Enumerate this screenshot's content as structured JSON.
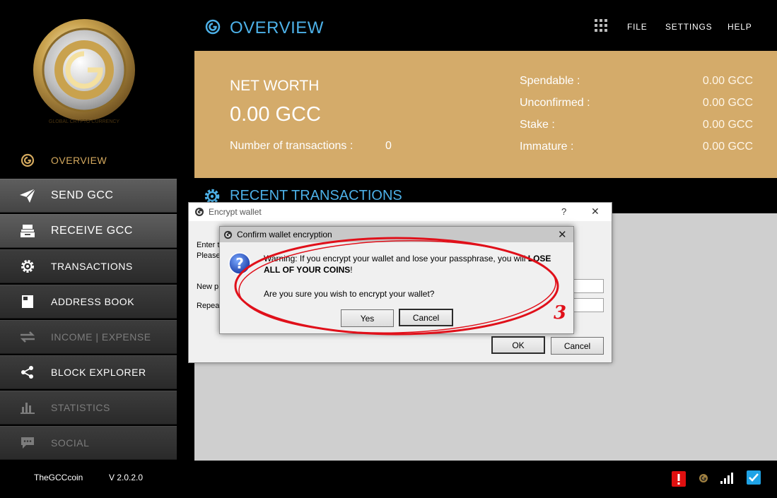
{
  "header": {
    "title": "OVERVIEW",
    "menu": [
      "FILE",
      "SETTINGS",
      "HELP"
    ]
  },
  "sidebar": {
    "items": [
      {
        "label": "OVERVIEW",
        "icon": "gcc-logo-icon"
      },
      {
        "label": "SEND GCC",
        "icon": "paper-plane-icon"
      },
      {
        "label": "RECEIVE GCC",
        "icon": "inbox-tray-icon"
      },
      {
        "label": "TRANSACTIONS",
        "icon": "gear-icon"
      },
      {
        "label": "ADDRESS BOOK",
        "icon": "book-icon"
      },
      {
        "label": "INCOME | EXPENSE",
        "icon": "exchange-arrows-icon"
      },
      {
        "label": "BLOCK EXPLORER",
        "icon": "share-icon"
      },
      {
        "label": "STATISTICS",
        "icon": "bar-chart-icon"
      },
      {
        "label": "SOCIAL",
        "icon": "chat-bubble-icon"
      }
    ]
  },
  "networth": {
    "label": "NET WORTH",
    "value": "0.00 GCC",
    "tx_label": "Number of transactions :",
    "tx_count": "0",
    "balances": [
      {
        "label": "Spendable :",
        "value": "0.00 GCC"
      },
      {
        "label": "Unconfirmed :",
        "value": "0.00 GCC"
      },
      {
        "label": "Stake :",
        "value": "0.00 GCC"
      },
      {
        "label": "Immature :",
        "value": "0.00 GCC"
      }
    ]
  },
  "recent": {
    "title": "RECENT TRANSACTIONS"
  },
  "footer": {
    "brand": "TheGCCcoin",
    "version": "V 2.0.2.0"
  },
  "encrypt_dialog": {
    "title": "Encrypt wallet",
    "help": "?",
    "close": "✕",
    "line1": "Enter t",
    "line2": "Please",
    "new_label": "New p",
    "repeat_label": "Repea",
    "ok": "OK",
    "cancel": "Cancel"
  },
  "confirm_dialog": {
    "title": "Confirm wallet encryption",
    "close": "✕",
    "warning_prefix": "Warning: If you encrypt your wallet and lose your passphrase, you will ",
    "warning_bold1": "LOSE",
    "warning_bold2": "ALL OF YOUR COINS",
    "warning_suffix": "!",
    "question": "Are you sure you wish to encrypt your wallet?",
    "yes": "Yes",
    "cancel": "Cancel"
  },
  "annotation": {
    "number": "3",
    "color": "#e0101a"
  },
  "colors": {
    "accent_blue": "#4db1e8",
    "gold": "#d4ab6a",
    "active_nav": "#d4a95e"
  }
}
